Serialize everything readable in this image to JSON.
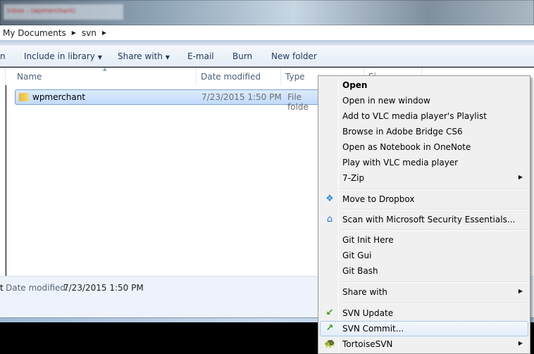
{
  "window": {
    "blurred_tab_title": "Inbox - (wpmerchant)"
  },
  "address_bar": {
    "crumbs": [
      "My Documents",
      "svn"
    ]
  },
  "toolbar": {
    "truncated_left": "n",
    "include_in_library": "Include in library",
    "share_with": "Share with",
    "email": "E-mail",
    "burn": "Burn",
    "new_folder": "New folder"
  },
  "columns": {
    "name": "Name",
    "date_modified": "Date modified",
    "type": "Type",
    "size": "Si"
  },
  "files": [
    {
      "name": "wpmerchant",
      "date_modified": "7/23/2015 1:50 PM",
      "type": "File folde"
    }
  ],
  "details": {
    "truncated_left": "t",
    "label": "Date modified:",
    "value": "7/23/2015 1:50 PM"
  },
  "context_menu": {
    "items": [
      {
        "label": "Open"
      },
      {
        "label": "Open in new window"
      },
      {
        "label": "Add to VLC media player's Playlist"
      },
      {
        "label": "Browse in Adobe Bridge CS6"
      },
      {
        "label": "Open as Notebook in OneNote"
      },
      {
        "label": "Play with VLC media player"
      },
      {
        "label": "7-Zip"
      },
      {
        "label": "Move to Dropbox",
        "icon": "dropbox-icon"
      },
      {
        "label": "Scan with Microsoft Security Essentials...",
        "icon": "security-essentials-icon"
      },
      {
        "label": "Git Init Here"
      },
      {
        "label": "Git Gui"
      },
      {
        "label": "Git Bash"
      },
      {
        "label": "Share with"
      },
      {
        "label": "SVN Update",
        "icon": "svn-update-icon"
      },
      {
        "label": "SVN Commit...",
        "icon": "svn-commit-icon"
      },
      {
        "label": "TortoiseSVN",
        "icon": "tortoisesvn-icon"
      }
    ],
    "highlight_color": "#e3edf9"
  }
}
